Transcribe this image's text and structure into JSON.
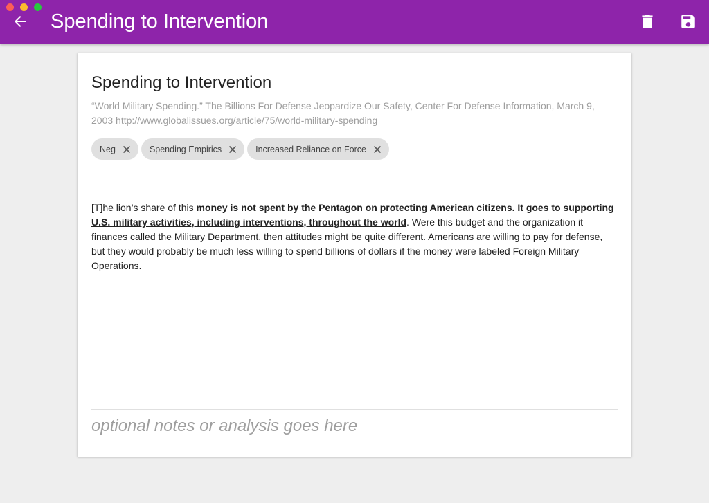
{
  "window": {
    "title": "Spending to Intervention"
  },
  "card": {
    "title": "Spending to Intervention",
    "citation": "“World Military Spending.” The Billions For Defense Jeopardize Our Safety, Center For Defense Information, March 9, 2003 http://www.globalissues.org/article/75/world-military-spending",
    "tags": [
      {
        "label": "Neg"
      },
      {
        "label": "Spending Empirics"
      },
      {
        "label": "Increased Reliance on Force"
      }
    ],
    "body": {
      "part1": "[T]he lion’s share of this",
      "emphasis": " money is not spent by the Pentagon on protecting American citizens. It goes to supporting U.S. military activities, including interventions, throughout the world",
      "part2": ". Were this budget and the organization it finances called the Military Department, then attitudes might be quite different. Americans are willing to pay for defense, but they would probably be much less willing to spend billions of dollars if the money were labeled Foreign Military Operations."
    },
    "notes": {
      "placeholder": "optional notes or analysis goes here",
      "value": ""
    }
  },
  "icons": {
    "back": "arrow-back-icon",
    "delete": "trash-icon",
    "save": "floppy-disk-icon",
    "chip_close": "close-icon"
  },
  "colors": {
    "appbar": "#8e24aa",
    "background": "#eeeeee",
    "chip": "#e0e0e0"
  }
}
